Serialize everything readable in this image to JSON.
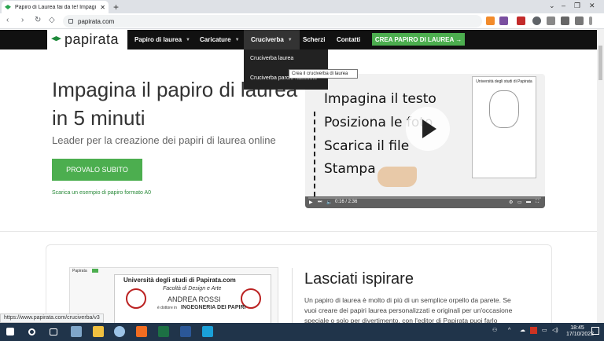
{
  "browser": {
    "tab_title": "Papiro di Laurea fai da te! Impagi",
    "url": "papirata.com",
    "status_url": "https://www.papirata.com/cruciverba/v3"
  },
  "site": {
    "logo": "papirata",
    "nav": [
      {
        "label": "Papiro di laurea",
        "caret": "▼"
      },
      {
        "label": "Caricature",
        "caret": "▼"
      },
      {
        "label": "Cruciverba",
        "caret": "▼"
      },
      {
        "label": "Scherzi"
      },
      {
        "label": "Contatti"
      }
    ],
    "cta_label": "CREA PAPIRO DI LAUREA →",
    "dropdown": [
      "Cruciverba laurea",
      "Cruciverba parole nascoste"
    ],
    "tooltip": "Crea il cruciverba di laurea"
  },
  "hero": {
    "title_line1": "Impagina il papiro di laurea",
    "title_line2": "in 5 minuti",
    "subtitle": "Leader per la creazione dei papiri di laurea online",
    "button": "PROVALO SUBITO",
    "link": "Scarica un esempio di papiro formato A0"
  },
  "video": {
    "lines": [
      "Impagina il testo",
      "Posiziona le foto",
      "Scarica il file",
      "Stampa"
    ],
    "time": "0:16 / 2:36",
    "poster_title": "Università degli studi di Papirata"
  },
  "section": {
    "title": "Lasciati ispirare",
    "body_1": "Un papiro di laurea è molto di più di un semplice orpello da parete. Se",
    "body_2": "vuoi creare dei papiri laurea personalizzati e originali per un'occasione",
    "body_3": "speciale o solo per divertimento, con l'editor di Papirata puoi farlo"
  },
  "preview": {
    "app_name": "Papirata",
    "poster_title": "Università degli studi di Papirata.com",
    "faculty": "Facoltà di Design e Arte",
    "name": "ANDREA ROSSI",
    "degree_prefix": "è dottore in",
    "degree": "INGEGNERIA DEI PAPIRI"
  },
  "taskbar": {
    "time": "18:45",
    "date": "17/10/2022"
  },
  "colors": {
    "brand_green": "#4cae4f",
    "header_bg": "#111111",
    "taskbar_bg": "#20344a"
  }
}
